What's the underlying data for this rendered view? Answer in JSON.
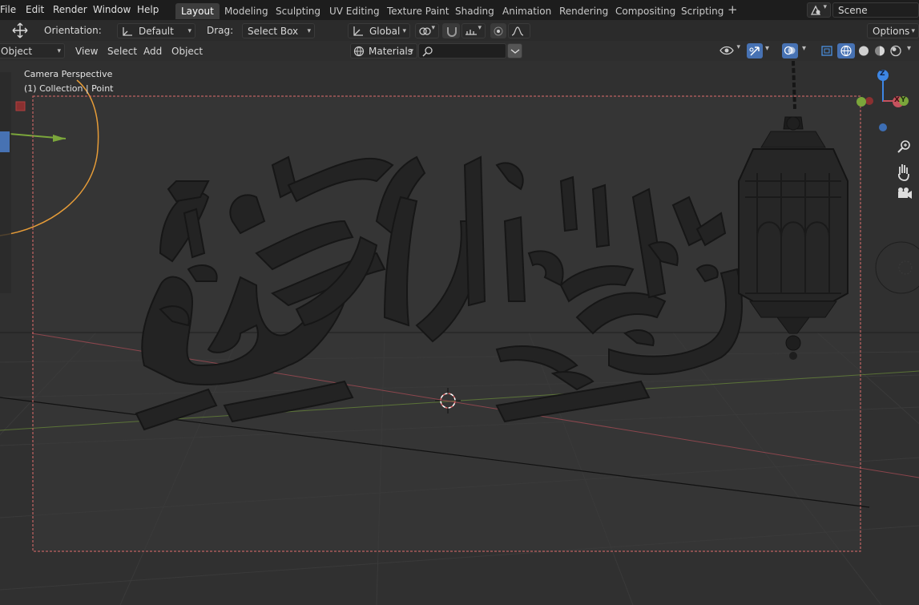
{
  "menus": [
    "File",
    "Edit",
    "Render",
    "Window",
    "Help"
  ],
  "workspaces": [
    "Layout",
    "Modeling",
    "Sculpting",
    "UV Editing",
    "Texture Paint",
    "Shading",
    "Animation",
    "Rendering",
    "Compositing",
    "Scripting"
  ],
  "add_workspace": "+",
  "scene": {
    "name": "Scene"
  },
  "toolbar": {
    "orientation_label": "Orientation:",
    "orientation_value": "Default",
    "drag_label": "Drag:",
    "drag_value": "Select Box",
    "transform_orientation": "Global",
    "options": "Options"
  },
  "viewport_header": {
    "mode": "Object Mode",
    "menus": [
      "View",
      "Select",
      "Add",
      "Object"
    ],
    "shading_target": "Materials"
  },
  "overlay": {
    "view_name": "Camera Perspective",
    "collection_info": "(1) Collection | Point"
  },
  "gizmo": {
    "z": "Z",
    "y": "Y",
    "x": "X"
  },
  "colors": {
    "accent": "#4772b3",
    "active_tab": "#3d3d3d",
    "camera_frame": "#e06b6b",
    "x_axis": "#c6525e",
    "y_axis": "#7ba63b",
    "z_axis": "#3d86e4",
    "light": "#e69c38"
  }
}
